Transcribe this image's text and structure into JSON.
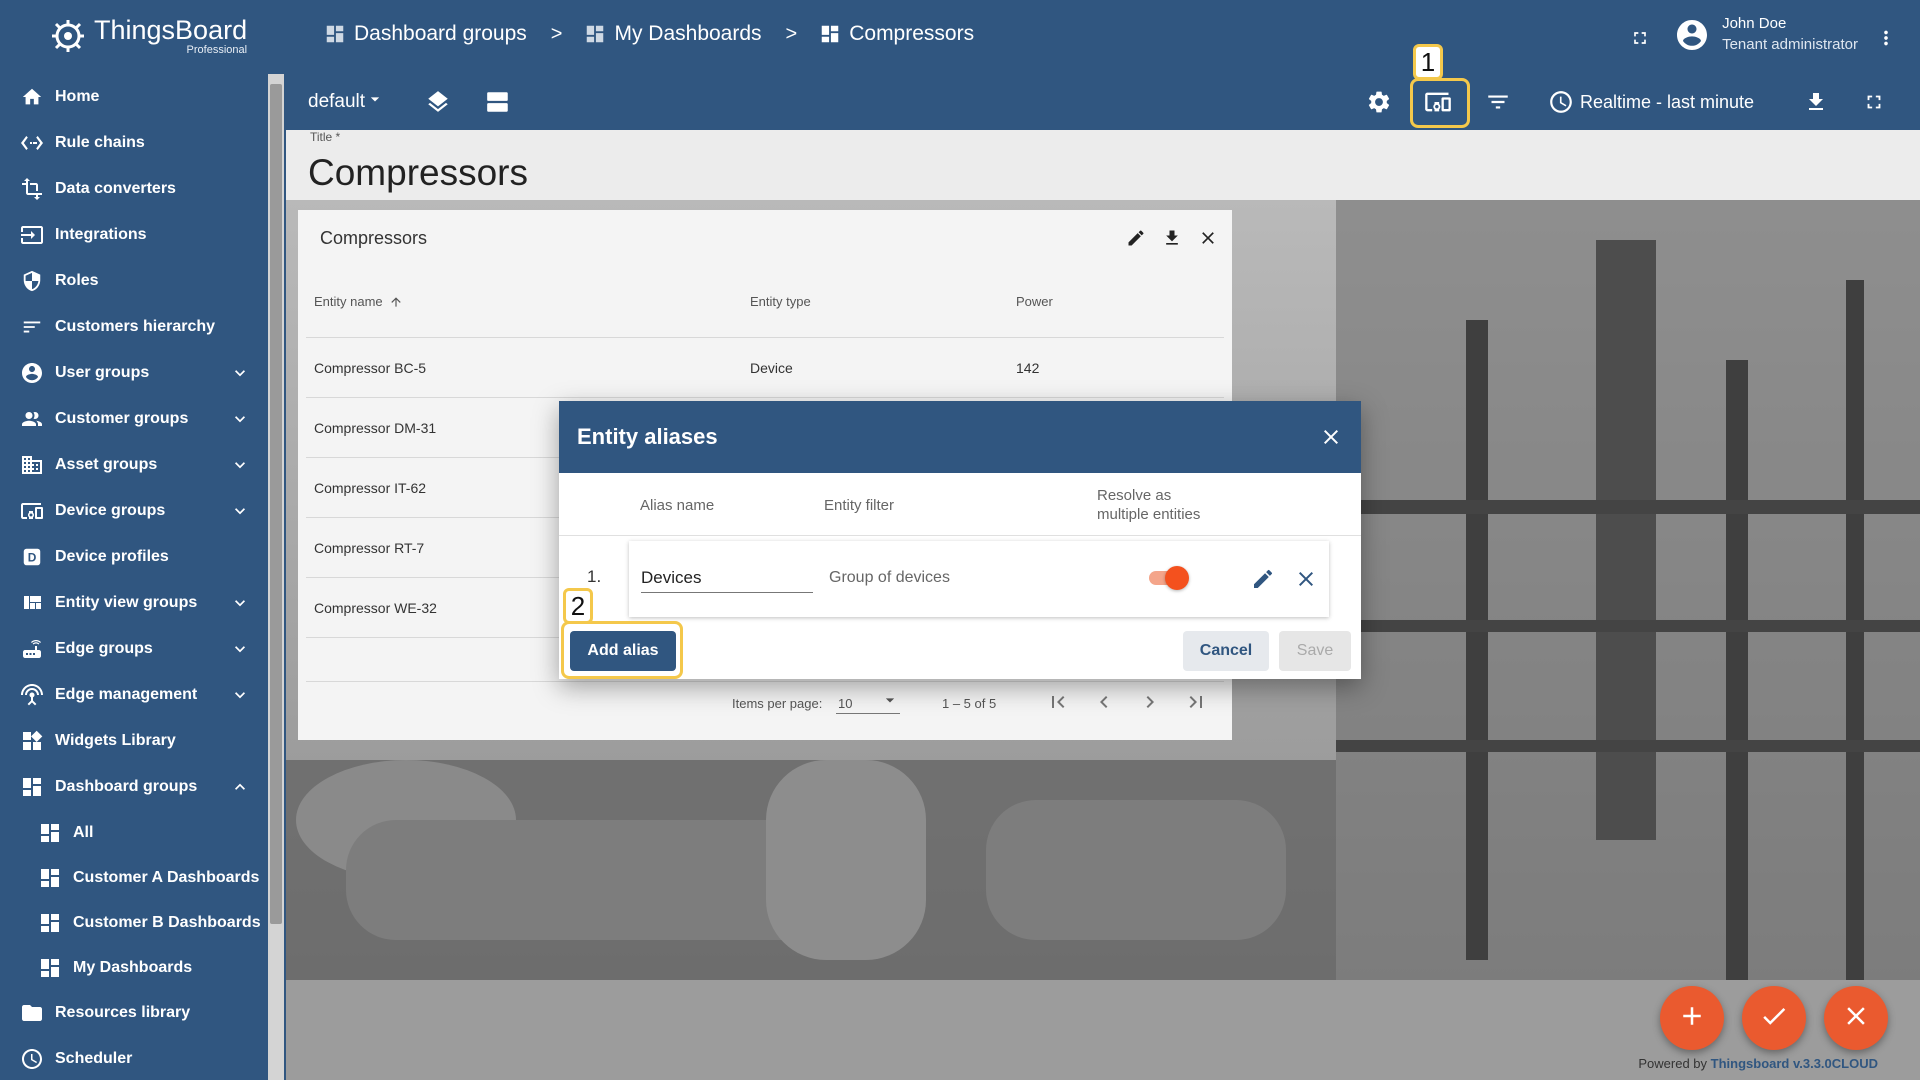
{
  "app": {
    "logo_text": "ThingsBoard",
    "logo_sub": "Professional"
  },
  "colors": {
    "primary": "#305680",
    "accent": "#f4511e",
    "highlight": "#f4c84b"
  },
  "sidebar": {
    "items": [
      {
        "label": "Home",
        "icon": "home-icon",
        "expandable": false
      },
      {
        "label": "Rule chains",
        "icon": "settings-ethernet-icon",
        "expandable": false
      },
      {
        "label": "Data converters",
        "icon": "transform-icon",
        "expandable": false
      },
      {
        "label": "Integrations",
        "icon": "input-icon",
        "expandable": false
      },
      {
        "label": "Roles",
        "icon": "shield-icon",
        "expandable": false
      },
      {
        "label": "Customers hierarchy",
        "icon": "sort-icon",
        "expandable": false
      },
      {
        "label": "User groups",
        "icon": "account-circle-icon",
        "expandable": true
      },
      {
        "label": "Customer groups",
        "icon": "supervisor-icon",
        "expandable": true
      },
      {
        "label": "Asset groups",
        "icon": "domain-icon",
        "expandable": true
      },
      {
        "label": "Device groups",
        "icon": "devices-other-icon",
        "expandable": true
      },
      {
        "label": "Device profiles",
        "icon": "device-profile-icon",
        "expandable": false
      },
      {
        "label": "Entity view groups",
        "icon": "view-quilt-icon",
        "expandable": true
      },
      {
        "label": "Edge groups",
        "icon": "router-icon",
        "expandable": true
      },
      {
        "label": "Edge management",
        "icon": "settings-input-antenna-icon",
        "expandable": true
      },
      {
        "label": "Widgets Library",
        "icon": "widgets-icon",
        "expandable": false
      },
      {
        "label": "Dashboard groups",
        "icon": "dashboard-icon",
        "expandable": true,
        "expanded": true
      }
    ],
    "sub_items": [
      {
        "label": "All"
      },
      {
        "label": "Customer A Dashboards"
      },
      {
        "label": "Customer B Dashboards"
      },
      {
        "label": "My Dashboards"
      }
    ],
    "after_items": [
      {
        "label": "Resources library",
        "icon": "folder-icon"
      },
      {
        "label": "Scheduler",
        "icon": "schedule-icon"
      }
    ]
  },
  "header": {
    "breadcrumb": [
      "Dashboard groups",
      "My Dashboards",
      "Compressors"
    ],
    "separator": ">",
    "user_name": "John Doe",
    "user_role": "Tenant administrator"
  },
  "toolbar": {
    "state_label": "default",
    "timewindow": "Realtime - last minute"
  },
  "annotations": {
    "badge_1": "1",
    "badge_2": "2"
  },
  "title_field": {
    "label": "Title *",
    "value": "Compressors"
  },
  "widget": {
    "title": "Compressors",
    "columns": [
      "Entity name",
      "Entity type",
      "Power"
    ],
    "rows": [
      {
        "name": "Compressor BC-5",
        "type": "Device",
        "power": "142"
      },
      {
        "name": "Compressor DM-31",
        "type": "",
        "power": ""
      },
      {
        "name": "Compressor IT-62",
        "type": "",
        "power": ""
      },
      {
        "name": "Compressor RT-7",
        "type": "",
        "power": ""
      },
      {
        "name": "Compressor WE-32",
        "type": "",
        "power": ""
      }
    ],
    "pager": {
      "items_per_page_label": "Items per page:",
      "items_per_page": "10",
      "range": "1 – 5 of 5"
    }
  },
  "modal": {
    "title": "Entity aliases",
    "headers": {
      "alias_name": "Alias name",
      "entity_filter": "Entity filter",
      "resolve_line1": "Resolve as",
      "resolve_line2": "multiple entities"
    },
    "aliases": [
      {
        "index": "1.",
        "name": "Devices",
        "filter": "Group of devices",
        "resolve_multiple": true
      }
    ],
    "add_label": "Add alias",
    "cancel_label": "Cancel",
    "save_label": "Save"
  },
  "footer": {
    "prefix": "Powered by",
    "link": "Thingsboard v.3.3.0CLOUD"
  }
}
